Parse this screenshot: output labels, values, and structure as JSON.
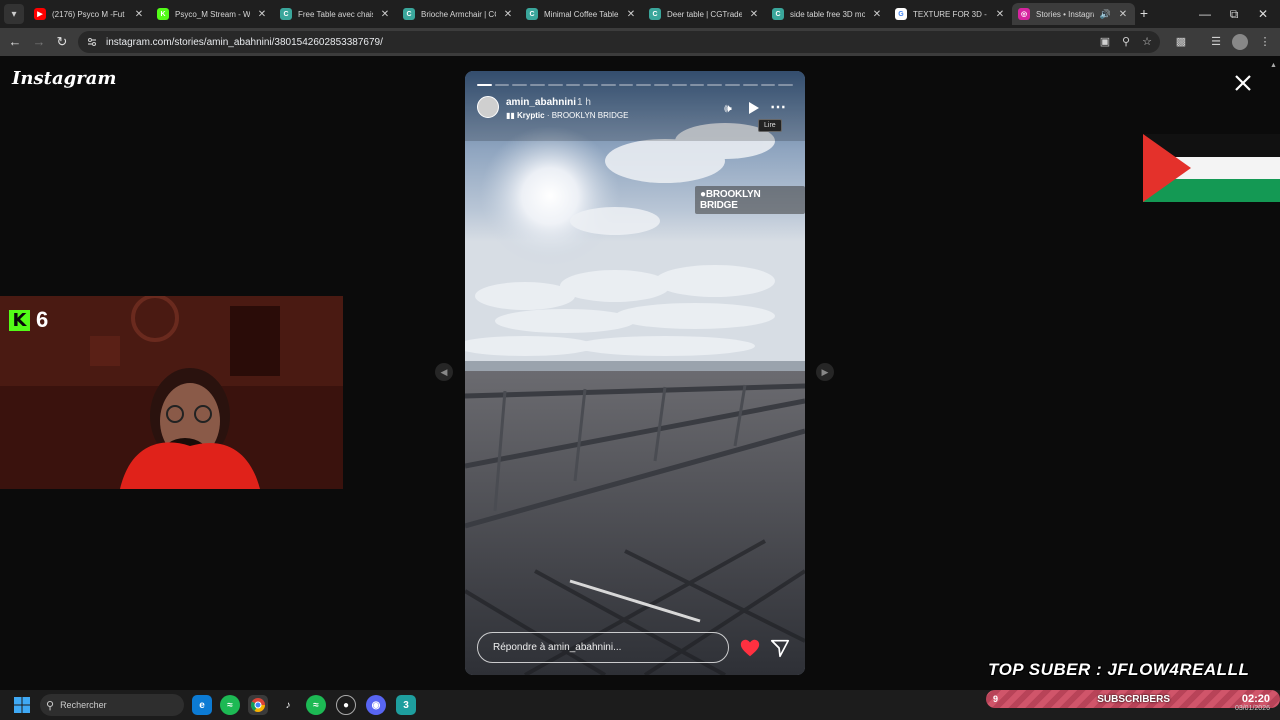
{
  "browser": {
    "tabs": [
      {
        "label": "(2176) Psyco M -Fut",
        "fav_color": "#ff0000",
        "fav_glyph": "▶",
        "active": false
      },
      {
        "label": "Psyco_M Stream - Wa",
        "fav_color": "#53fc18",
        "fav_glyph": "K",
        "active": false
      },
      {
        "label": "Free Table avec chaise",
        "fav_color": "#3aa69b",
        "fav_glyph": "C",
        "active": false
      },
      {
        "label": "Brioche Armchair | CG",
        "fav_color": "#3aa69b",
        "fav_glyph": "C",
        "active": false
      },
      {
        "label": "Minimal Coffee Table",
        "fav_color": "#3aa69b",
        "fav_glyph": "C",
        "active": false
      },
      {
        "label": "Deer table | CGTrader",
        "fav_color": "#3aa69b",
        "fav_glyph": "C",
        "active": false
      },
      {
        "label": "side table free 3D mo",
        "fav_color": "#3aa69b",
        "fav_glyph": "C",
        "active": false
      },
      {
        "label": "TEXTURE FOR 3D - G",
        "fav_color": "#ffffff",
        "fav_glyph": "G",
        "active": false
      },
      {
        "label": "Stories • Instagra",
        "fav_color": "#d6249f",
        "fav_glyph": "◎",
        "active": true
      }
    ],
    "url": "instagram.com/stories/amin_abahnini/3801542602853387679/"
  },
  "instagram": {
    "logo": "Instagram",
    "story": {
      "username": "amin_abahnini",
      "time_ago": "1 h",
      "music_artist": "Kryptic",
      "music_track": " · BROOKLYN BRIDGE",
      "location_sticker": "BROOKLYN BRIDGE",
      "tooltip": "Lire",
      "reply_placeholder": "Répondre à amin_abahnini...",
      "progress_segments": 18,
      "progress_done": 1,
      "icons": [
        "volume-icon",
        "play-icon",
        "more-icon",
        "heart-icon",
        "share-icon",
        "close-icon"
      ]
    }
  },
  "overlay": {
    "kick_viewers": "6",
    "top_suber": "TOP SUBER : JFLOW4REALLL",
    "subs_count": "9",
    "subs_label": "SUBSCRIBERS"
  },
  "taskbar": {
    "search_label": "Rechercher",
    "time": "02:20",
    "date": "03/01/2026"
  },
  "colors": {
    "kick_green": "#53fc18",
    "heart_red": "#ff3040",
    "chrome_dark": "#1f1f1f"
  }
}
